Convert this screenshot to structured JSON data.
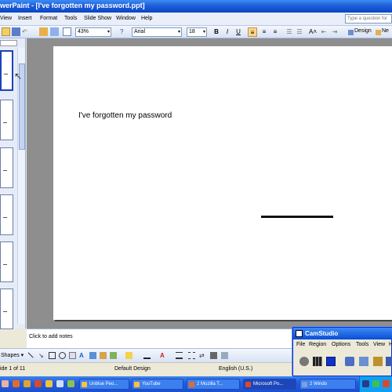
{
  "window": {
    "title": "werPaint - [I've forgotten my password.ppt]"
  },
  "menu": {
    "items": [
      "View",
      "Insert",
      "Format",
      "Tools",
      "Slide Show",
      "Window",
      "Help"
    ]
  },
  "help_box": {
    "placeholder": "Type a question for"
  },
  "toolbar": {
    "zoom": "43%",
    "font": "Arial",
    "font_size": "18",
    "bold": "B",
    "italic": "I",
    "underline": "U",
    "grow_font": "A˄",
    "design_label": "Design",
    "new_label": "Ne"
  },
  "left_pane": {
    "thumb_count": 6
  },
  "slide": {
    "text": "I've forgotten my password"
  },
  "notes": {
    "placeholder": "Click to add notes"
  },
  "drawing": {
    "autoshapes_label": "Shapes ▾"
  },
  "status": {
    "slide_position": "ide 1 of 11",
    "design": "Default Design",
    "language": "English (U.S.)"
  },
  "taskbar": {
    "items": [
      "Unblue Peo...",
      "YouTube",
      "2 Mozilla T...",
      "Microsoft Po...",
      "2 Windo"
    ],
    "active_index": 3
  },
  "camstudio": {
    "title": "CamStudio",
    "menu": [
      "File",
      "Region",
      "Options",
      "Tools",
      "View",
      "H"
    ]
  },
  "colors": {
    "titlebar": "#1f5fd8",
    "taskbar": "#245edb",
    "slide_background": "#ffffff",
    "canvas_background": "#8e8e8e",
    "active_button": "#f9d588"
  }
}
